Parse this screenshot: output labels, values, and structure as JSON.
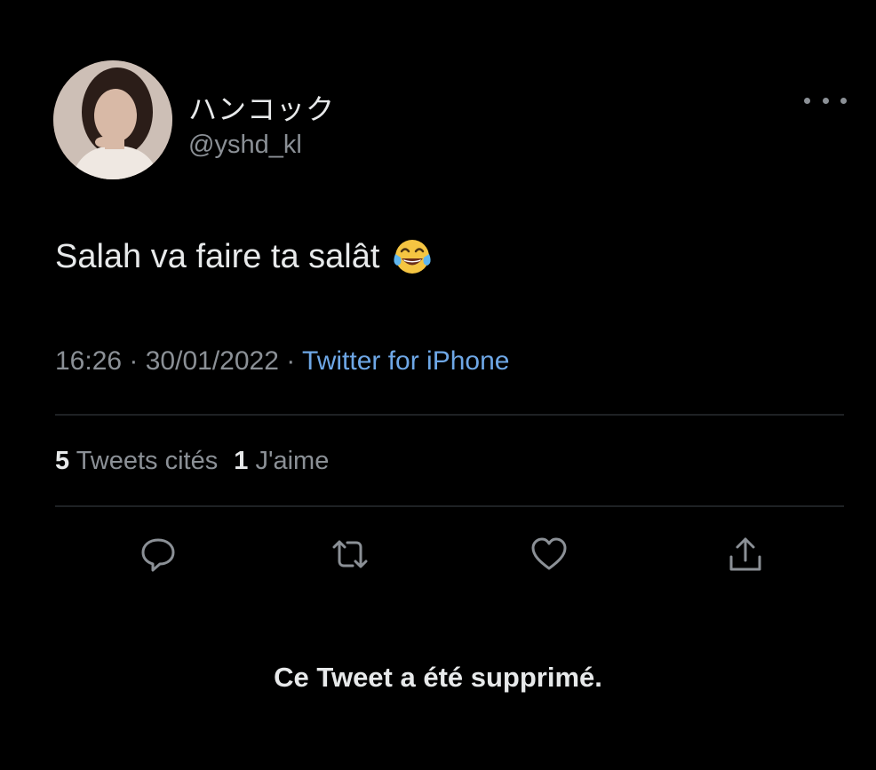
{
  "tweet": {
    "display_name": "ハンコック",
    "handle": "@yshd_kl",
    "text": "Salah va faire ta salât",
    "emoji": "face-with-tears-of-joy",
    "time": "16:26",
    "separator1": " · ",
    "date": "30/01/2022",
    "separator2": " · ",
    "source": "Twitter for iPhone",
    "stats": {
      "quotes_count": "5",
      "quotes_label": "Tweets cités",
      "likes_count": "1",
      "likes_label": "J'aime"
    },
    "actions": [
      "reply-icon",
      "retweet-icon",
      "like-icon",
      "share-icon"
    ]
  },
  "notice": "Ce Tweet a été supprimé.",
  "colors": {
    "background": "#000000",
    "primary_text": "#e7e9ea",
    "secondary_text": "#8b9096",
    "link": "#6ea7e6",
    "divider": "#1e2124"
  }
}
